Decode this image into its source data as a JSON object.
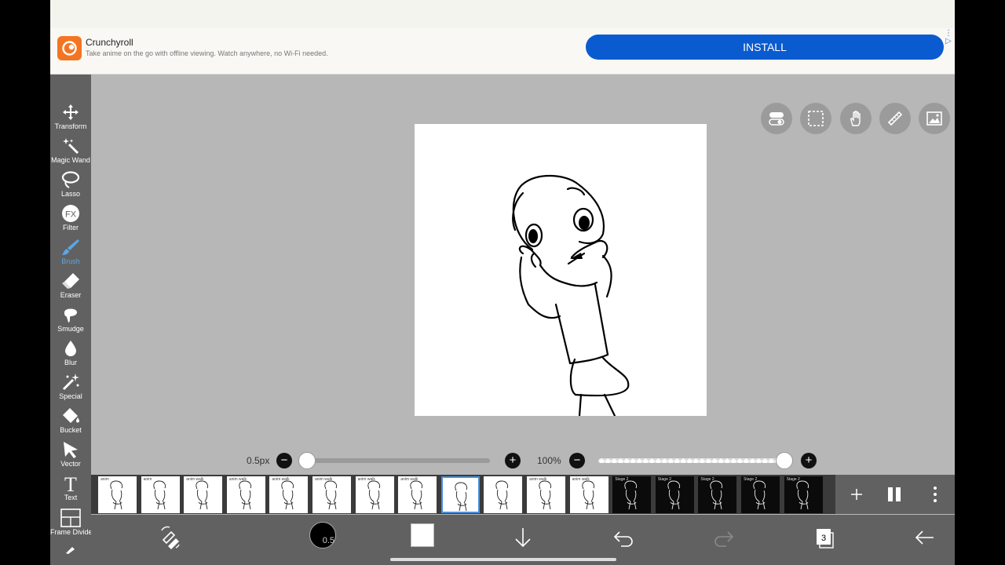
{
  "ad": {
    "brand": "Crunchyroll",
    "tagline": "Take anime on the go with offline viewing. Watch anywhere, no Wi-Fi needed.",
    "install_label": "INSTALL",
    "info_icon": "ad-info-icon"
  },
  "toolbar": {
    "tools": [
      {
        "label": "Transform",
        "icon": "move-arrows-icon"
      },
      {
        "label": "Magic Wand",
        "icon": "magic-wand-icon"
      },
      {
        "label": "Lasso",
        "icon": "lasso-icon"
      },
      {
        "label": "Filter",
        "icon": "fx-icon",
        "glyph": "FX"
      },
      {
        "label": "Brush",
        "icon": "brush-icon",
        "active": true
      },
      {
        "label": "Eraser",
        "icon": "eraser-icon"
      },
      {
        "label": "Smudge",
        "icon": "smudge-icon"
      },
      {
        "label": "Blur",
        "icon": "blur-drop-icon"
      },
      {
        "label": "Special",
        "icon": "special-sparkle-icon"
      },
      {
        "label": "Bucket",
        "icon": "bucket-icon"
      },
      {
        "label": "Vector",
        "icon": "vector-cursor-icon"
      },
      {
        "label": "Text",
        "icon": "text-icon",
        "glyph": "T"
      },
      {
        "label": "Frame Divider",
        "icon": "frame-divider-icon"
      }
    ]
  },
  "right_tools": [
    "toggle-icon",
    "selection-icon",
    "hand-icon",
    "ruler-icon",
    "image-icon"
  ],
  "brush_size": {
    "label": "0.5px",
    "minus": "−",
    "plus": "+",
    "value_fraction": 0.0
  },
  "opacity": {
    "label": "100%",
    "minus": "−",
    "plus": "+",
    "value_fraction": 1.0
  },
  "frames": {
    "items": [
      {
        "caption": "anim",
        "style": "light"
      },
      {
        "caption": "anim",
        "style": "light"
      },
      {
        "caption": "anim walk",
        "style": "light"
      },
      {
        "caption": "anim walk",
        "style": "light"
      },
      {
        "caption": "anim walk",
        "style": "light"
      },
      {
        "caption": "anim walk",
        "style": "light"
      },
      {
        "caption": "anim walk",
        "style": "light"
      },
      {
        "caption": "anim walk",
        "style": "light"
      },
      {
        "caption": "",
        "style": "light",
        "selected": true
      },
      {
        "caption": "",
        "style": "light"
      },
      {
        "caption": "anim walk",
        "style": "light"
      },
      {
        "caption": "anim walk",
        "style": "light"
      },
      {
        "caption": "Stage 2",
        "style": "dark"
      },
      {
        "caption": "Stage 2",
        "style": "dark"
      },
      {
        "caption": "Stage 2",
        "style": "dark"
      },
      {
        "caption": "Stage 2",
        "style": "dark"
      },
      {
        "caption": "Stage 2",
        "style": "dark"
      }
    ],
    "add_icon": "add-frame-icon",
    "pause_icon": "pause-icon",
    "more_icon": "more-vertical-icon"
  },
  "bottom_bar": {
    "swap_icon": "swap-brush-eraser-icon",
    "brush_size_badge": "0.5",
    "color_swatch": "#ffffff",
    "down_icon": "arrow-down-icon",
    "undo_icon": "undo-icon",
    "redo_icon": "redo-icon",
    "layers_count": "3",
    "back_icon": "back-arrow-icon"
  }
}
